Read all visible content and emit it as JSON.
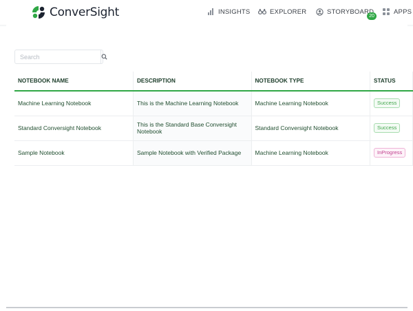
{
  "brand": {
    "name": "ConverSight",
    "primary": "#2fa745"
  },
  "nav": {
    "insights": "INSIGHTS",
    "explorer": "EXPLORER",
    "storyboard": "STORYBOARD",
    "storyboard_badge": "20",
    "apps": "APPS S"
  },
  "search": {
    "placeholder": "Search"
  },
  "table": {
    "headers": [
      "NOTEBOOK NAME",
      "DESCRIPTION",
      "NOTEBOOK TYPE",
      "STATUS"
    ],
    "rows": [
      {
        "name": "Machine Learning Notebook",
        "description": "This is the Machine Learning Notebook",
        "type": "Machine Learning Notebook",
        "status": "Success"
      },
      {
        "name": "Standard Conversight Notebook",
        "description": "This is the Standard Base Conversight Notebook",
        "type": "Standard Conversight Notebook",
        "status": "Success"
      },
      {
        "name": "Sample Notebook",
        "description": "Sample Notebook with Verified Package",
        "type": "Machine Learning Notebook",
        "status": "InProgress"
      }
    ]
  }
}
